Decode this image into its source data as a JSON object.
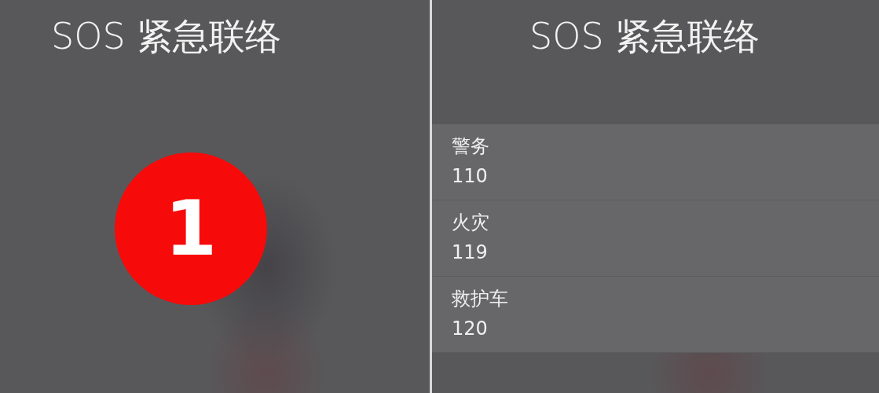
{
  "panels": [
    {
      "kind": "countdown",
      "title": "SOS 紧急联络",
      "badge": {
        "count": "1"
      }
    },
    {
      "kind": "contacts",
      "title": "SOS 紧急联络",
      "contacts": [
        {
          "name": "警务",
          "number": "110"
        },
        {
          "name": "火灾",
          "number": "119"
        },
        {
          "name": "救护车",
          "number": "120"
        }
      ]
    }
  ]
}
